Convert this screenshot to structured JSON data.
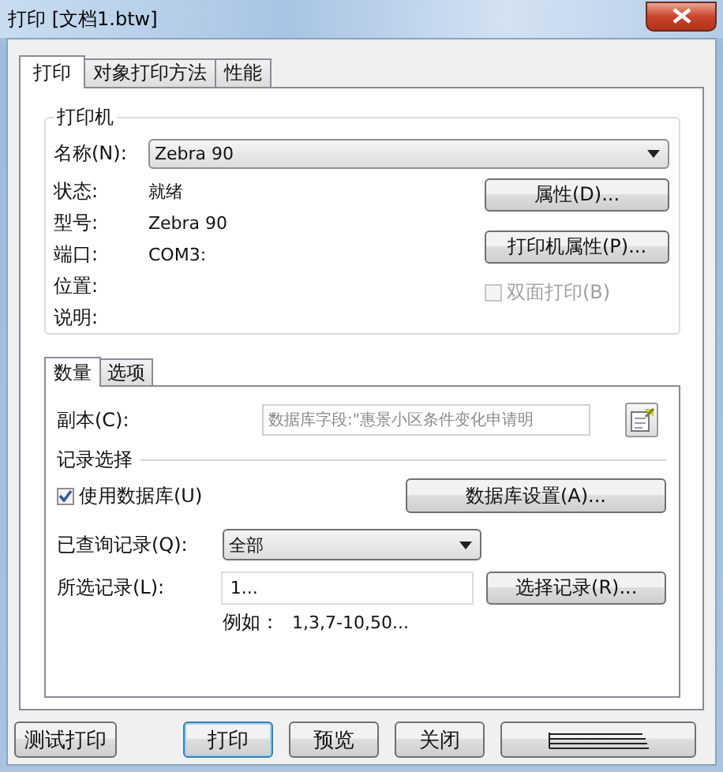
{
  "window": {
    "title": "打印 [文档1.btw]"
  },
  "tabs": [
    {
      "label": "打印",
      "selected": true
    },
    {
      "label": "对象打印方法",
      "selected": false
    },
    {
      "label": "性能",
      "selected": false
    }
  ],
  "printer": {
    "title": "打印机",
    "name_label": "名称(N):",
    "name_value": "Zebra 90",
    "info": [
      {
        "label": "状态:",
        "value": "就绪"
      },
      {
        "label": "型号:",
        "value": "Zebra 90"
      },
      {
        "label": "端口:",
        "value": "COM3:"
      },
      {
        "label": "位置:"
      },
      {
        "label": "说明:"
      }
    ],
    "buttons": [
      "属性(D)...",
      "打印机属性(P)..."
    ],
    "duplex": {
      "label": "双面打印(B)",
      "checked": false,
      "disabled": true
    }
  },
  "sub_tabs": [
    {
      "label": "数量",
      "selected": true
    },
    {
      "label": "选项",
      "selected": false
    }
  ],
  "copies": {
    "label": "副本(C):",
    "value": "数据库字段:\"惠景小区条件变化申请明",
    "disabled": true
  },
  "record_selection": {
    "title": "记录选择",
    "use_database": {
      "label": "使用数据库(U)",
      "checked": true
    },
    "database_button": "数据库设置(A)...",
    "queried": {
      "label": "已查询记录(Q):",
      "value": "全部"
    },
    "selected_records": {
      "label": "所选记录(L):",
      "value": "1...",
      "button": "选择记录(R)..."
    },
    "example_label": "例如：",
    "example_value": "1,3,7-10,50..."
  },
  "buttons": [
    {
      "kind": "text",
      "label": "测试打印",
      "default": false
    },
    {
      "kind": "text",
      "label": "打印",
      "default": true
    },
    {
      "kind": "text",
      "label": "预览",
      "default": false
    },
    {
      "kind": "text",
      "label": "关闭",
      "default": false
    },
    {
      "kind": "icon",
      "default": false
    }
  ]
}
